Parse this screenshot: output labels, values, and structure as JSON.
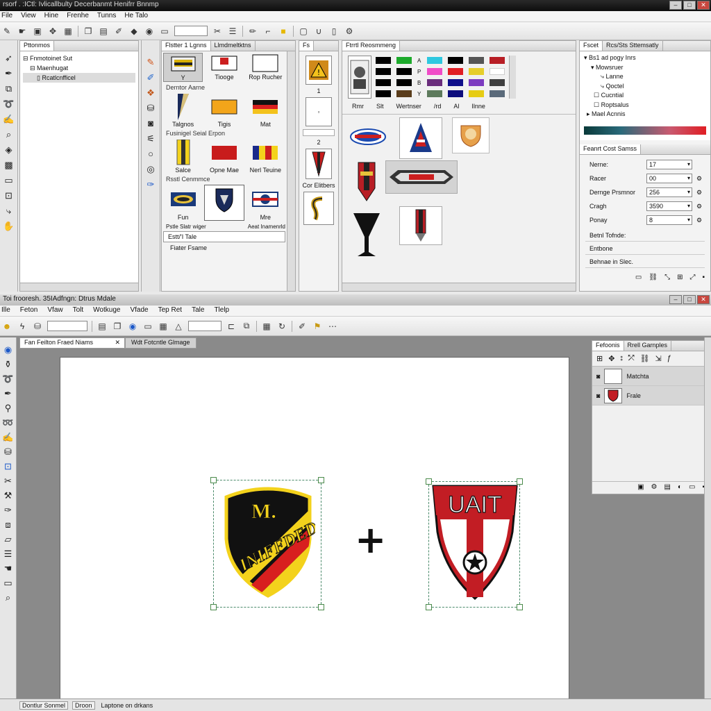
{
  "top_window": {
    "title": "rsorf . :ICtl: Ivlicallbulty Decerbanmt Henifrr Bnnmp",
    "menu": [
      "File",
      "View",
      "Hine",
      "Frenhe",
      "Tunns",
      "He Talo"
    ],
    "panels": {
      "tree": {
        "tab": "Pttonmos",
        "items": [
          "Fnmotoinet Sut",
          "Maenhugat",
          "Rcatlcnfficel"
        ]
      },
      "shapes": {
        "tabs": [
          "Flstter 1 Lgnns",
          "Llmdmeltktns"
        ],
        "row1": [
          "Y",
          "Tiooge",
          "Rop Rucher"
        ],
        "cat1": "Derntor Aarne",
        "row2": [
          "Talgnos",
          "Tigis",
          "Mat"
        ],
        "cat2": "Fusinigel Seial Erpon",
        "row3": [
          "Salce",
          "Opne Mae",
          "Nerl Teuine"
        ],
        "cat3": "Rsstl Cenmmce",
        "row4": [
          "Fun",
          "",
          "Mre"
        ],
        "cat4_left": "Pstle Slatr wiger",
        "cat4_right": "Aeat Inamenrld",
        "field": "Estt/'I Tale",
        "footer": "Fiater Fsame"
      },
      "middle": {
        "tab": "Fs",
        "labels": [
          "1",
          "2",
          "Cor Elitbers"
        ]
      },
      "swatches": {
        "tab": "Ftrrtl Reosmmeng",
        "letters": [
          "A",
          "P",
          "B",
          "Y"
        ],
        "colors": [
          [
            "#000000",
            "#1daa2c",
            "#2ec8e0",
            "#000000",
            "#555555",
            "#b81e25"
          ],
          [
            "#000000",
            "#000000",
            "#f04cc8",
            "#e01e24",
            "#e6ce2c",
            "#ffffff"
          ],
          [
            "#000000",
            "#000000",
            "#6a2d7c",
            "#0f0f8a",
            "#7c3bc0",
            "#3f3f3f"
          ],
          [
            "#000000",
            "#5a3d1c",
            "#5d7a5c",
            "#0d0d7c",
            "#e6cc14",
            "#5a6a7a"
          ]
        ],
        "sub_tabs": [
          "Rmr",
          "Slt",
          "Wertnser",
          "/rd",
          "Al",
          "Ilnne"
        ]
      },
      "props": {
        "tabs": [
          "Fscet",
          "Rcs/Sts Sttemsatly"
        ],
        "tree": [
          "Bs1 ad pogy Inrs",
          "Mowsruer",
          "Lanne",
          "Qoctel",
          "Cucntial",
          "Roptsalus",
          "Mael Acnnis"
        ],
        "section": "Feanrt Cost Samss",
        "rows": [
          {
            "label": "Nerne:",
            "value": "17"
          },
          {
            "label": "Racer",
            "value": "00"
          },
          {
            "label": "Dernge Prsmnor",
            "value": "256"
          },
          {
            "label": "Cragh",
            "value": "3590"
          },
          {
            "label": "Ponay",
            "value": "8"
          }
        ],
        "buttons": [
          "Betnl Tofnde:",
          "Entbone",
          "Behnae in Slec."
        ]
      }
    }
  },
  "bottom_window": {
    "title": "Toi frooresh. 35IAdfngn: Dtrus Mdale",
    "menu": [
      "Ille",
      "Feton",
      "Vfaw",
      "Tolt",
      "Wotkuge",
      "Vfade",
      "Tep Ret",
      "Tale",
      "Tlelp"
    ],
    "doc_tabs": [
      "Fan Feilton Fraed Niams",
      "Wdt Fotcntle Glmage"
    ],
    "layers": {
      "tabs": [
        "Fefoonis",
        "Rrell Garnples"
      ],
      "items": [
        "Matchta",
        "Frale"
      ]
    },
    "canvas": {
      "plus": "+",
      "badge_left": {
        "top_text": "M.",
        "band_text": "INIFFDED"
      },
      "badge_right": {
        "text": "UAIT"
      }
    },
    "status": [
      "Dontlur Sonmel",
      "Droon",
      "Laptone on drkans"
    ]
  },
  "colors": {
    "badge_black": "#111111",
    "badge_yellow": "#f3d21c",
    "badge_red": "#d81f1f",
    "badge2_red": "#c21d24"
  }
}
